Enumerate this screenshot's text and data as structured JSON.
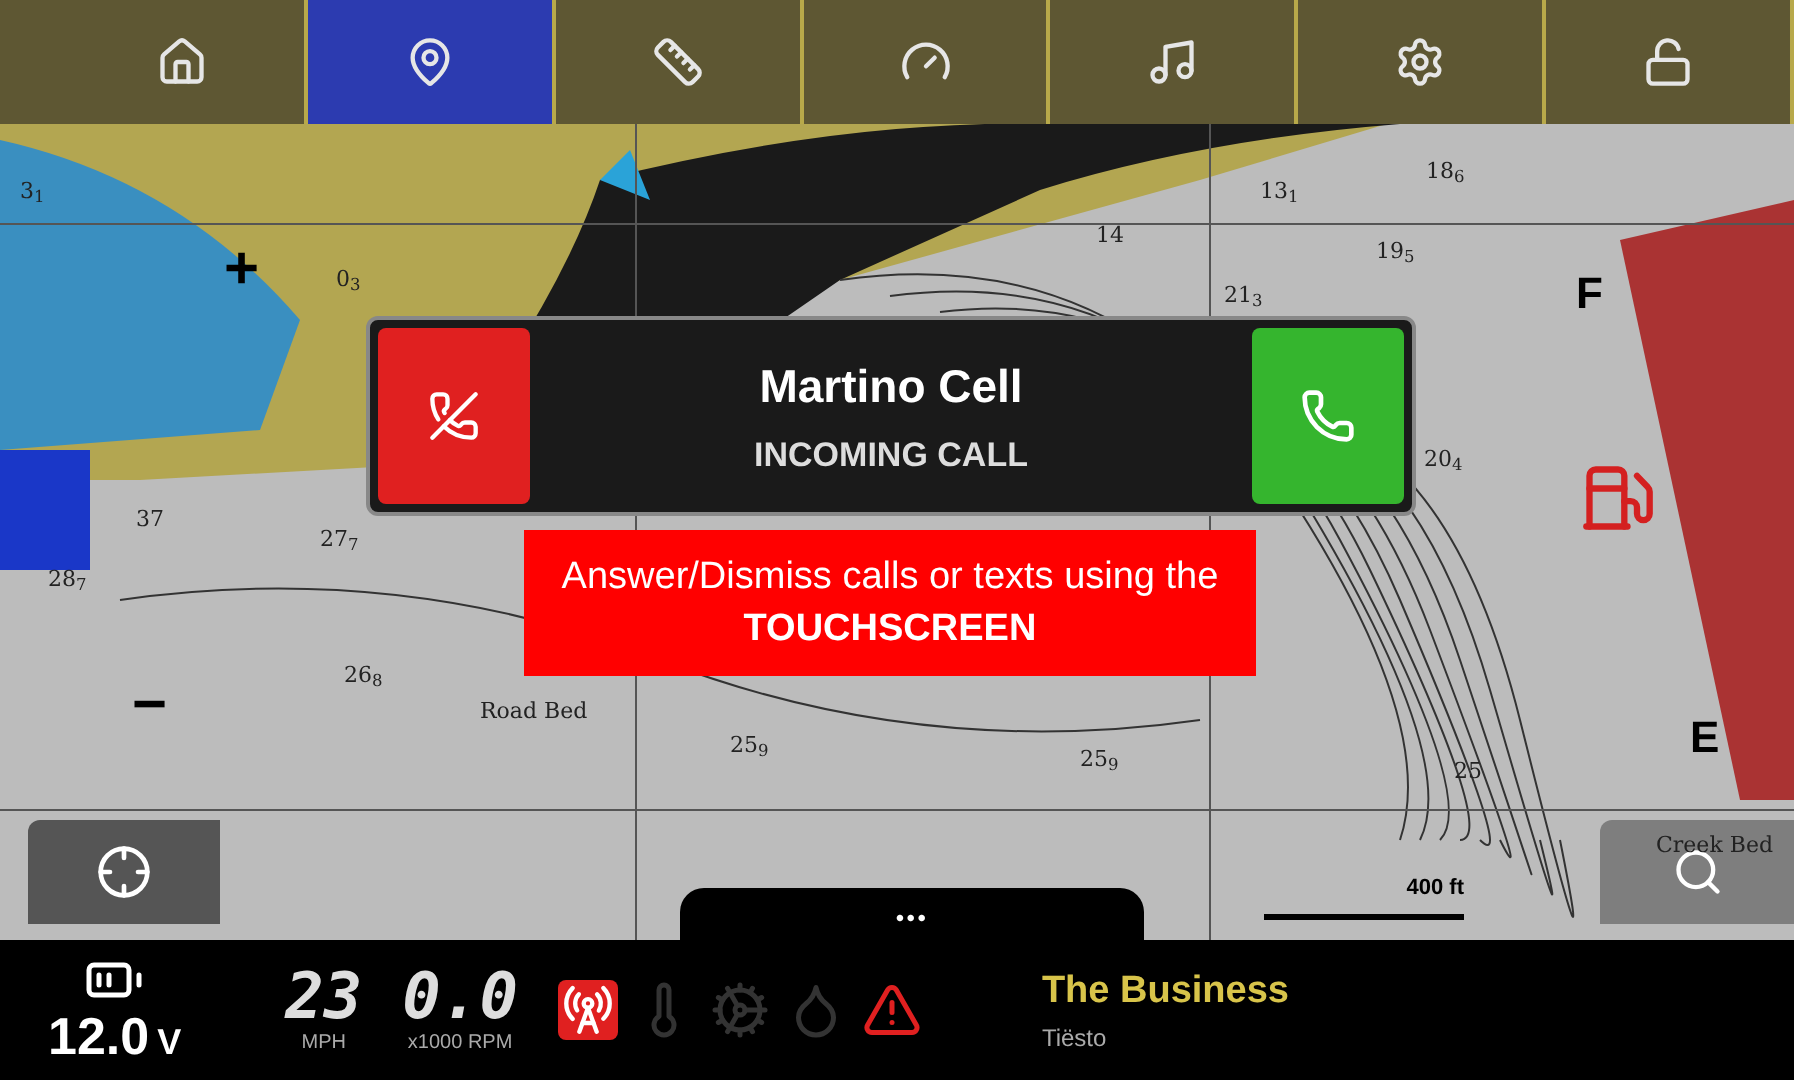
{
  "nav_tabs": [
    {
      "kind": "home",
      "selected": false
    },
    {
      "kind": "location",
      "selected": true
    },
    {
      "kind": "ruler",
      "selected": false
    },
    {
      "kind": "gauge",
      "selected": false
    },
    {
      "kind": "music",
      "selected": false
    },
    {
      "kind": "settings",
      "selected": false
    },
    {
      "kind": "unlock",
      "selected": false
    }
  ],
  "map": {
    "zoom_in": "+",
    "zoom_out": "−",
    "fuel_full": "F",
    "fuel_empty": "E",
    "scale": "400 ft",
    "labels": [
      "3$_{1}$",
      "0$_{3}$",
      "14",
      "13$_{1}$",
      "18$_{6}$",
      "19$_{5}$",
      "21$_{3}$",
      "20$_{4}$",
      "27$_{7}$",
      "28$_{7}$",
      "37",
      "26$_{8}$",
      "Road Bed",
      "25$_{9}$",
      "25$_{9}$",
      "25",
      "Creek Bed"
    ]
  },
  "call": {
    "caller": "Martino Cell",
    "status": "INCOMING CALL"
  },
  "caption": "Answer/Dismiss calls or texts using the **TOUCHSCREEN**",
  "more_tab": "•••",
  "status_bar": {
    "voltage": "12.0",
    "voltage_unit": "V",
    "speed": "23",
    "speed_unit": "MPH",
    "rpm": "0.0",
    "rpm_unit": "x1000 RPM",
    "indicators": [
      {
        "kind": "signal",
        "active": true
      },
      {
        "kind": "temperature",
        "active": false
      },
      {
        "kind": "engine",
        "active": false
      },
      {
        "kind": "oil",
        "active": false
      },
      {
        "kind": "warning",
        "active": true
      }
    ],
    "song": "The Business",
    "artist": "Tiësto"
  }
}
